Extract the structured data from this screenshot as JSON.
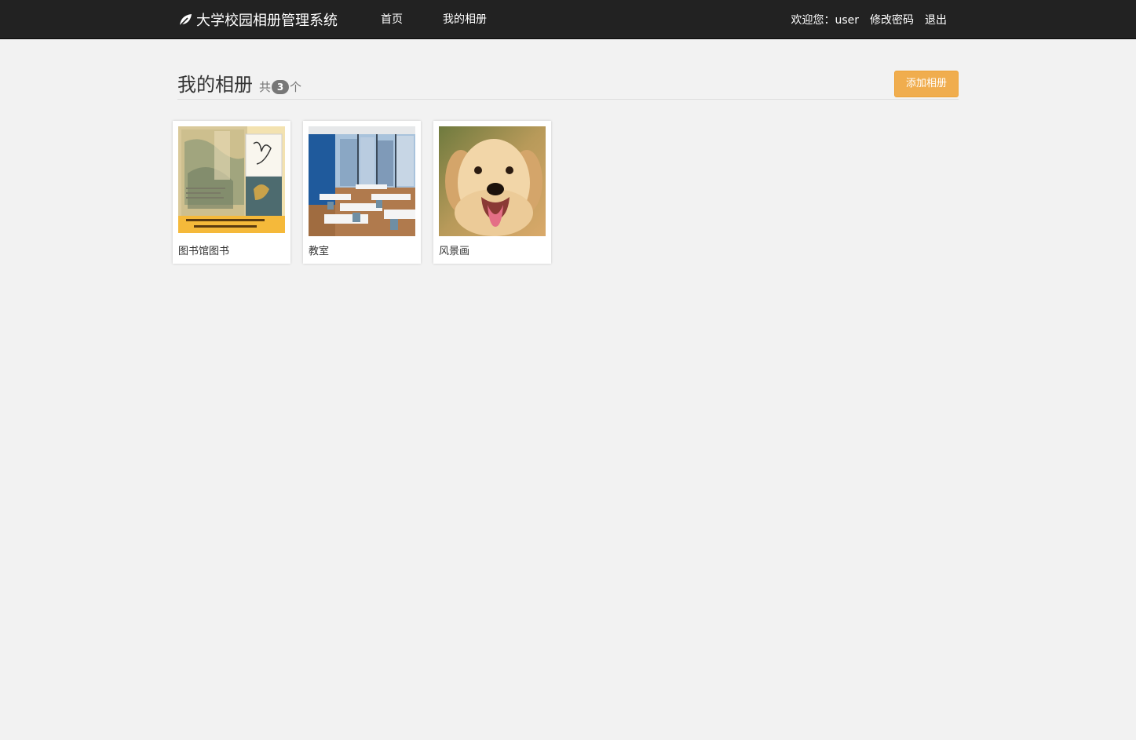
{
  "navbar": {
    "brand": "大学校园相册管理系统",
    "brand_icon": "leaf-icon",
    "links": {
      "home": "首页",
      "my_albums": "我的相册"
    },
    "welcome": "欢迎您：user",
    "change_password": "修改密码",
    "logout": "退出"
  },
  "header": {
    "title": "我的相册",
    "count_prefix": "共",
    "count": "3",
    "count_suffix": "个",
    "add_button": "添加相册"
  },
  "albums": [
    {
      "name": "图书馆图书",
      "cover": "book-cover-image"
    },
    {
      "name": "教室",
      "cover": "classroom-image"
    },
    {
      "name": "风景画",
      "cover": "dog-image"
    }
  ],
  "colors": {
    "navbar_bg": "#222222",
    "page_bg": "#f2f2f2",
    "accent_warning": "#f0ad4e",
    "badge": "#777777"
  }
}
